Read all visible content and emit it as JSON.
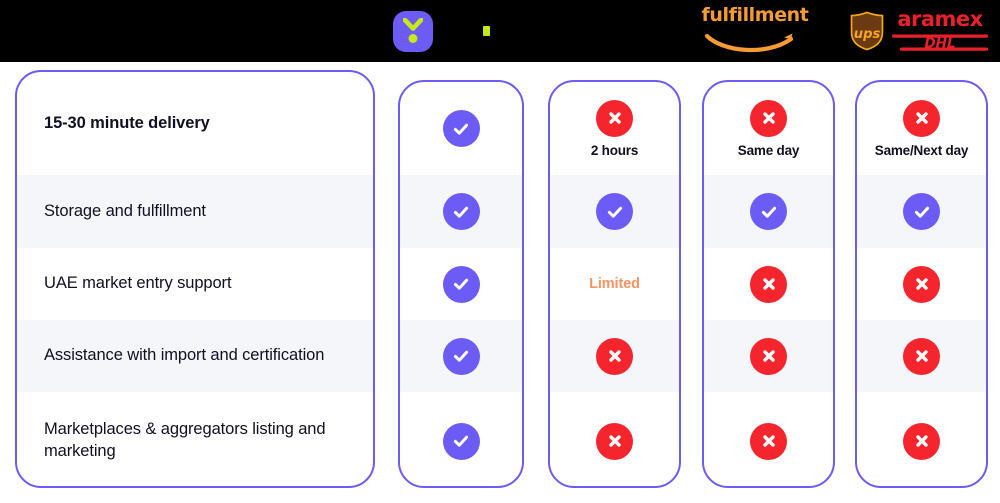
{
  "header": {
    "background": "#000000",
    "logos": [
      {
        "name": "brand-logo",
        "label": "Y",
        "colors": {
          "bg": "#6c5cf5",
          "mark": "#c8e819"
        }
      },
      {
        "name": "partial-logo",
        "label": "",
        "colors": {
          "mark": "#c8e819"
        }
      },
      {
        "name": "amazon-fulfillment-logo",
        "label": "fulfillment",
        "colors": {
          "mark": "#f79b34"
        }
      },
      {
        "name": "carrier-logos",
        "ups_label": "ups",
        "aramex_label": "aramex",
        "dhl_label": "DHL",
        "colors": {
          "ups": "#6b3a11",
          "ups_gold": "#f5a623",
          "red": "#e8212b"
        }
      }
    ]
  },
  "theme": {
    "purple": "#6c5cf5",
    "red": "#f5252d",
    "orange": "#f89461",
    "band": "#f5f6fa",
    "text": "#101021"
  },
  "table": {
    "features": [
      {
        "label": "15-30 minute delivery",
        "bold": true,
        "shaded": false
      },
      {
        "label": "Storage and fulfillment",
        "bold": false,
        "shaded": true
      },
      {
        "label": "UAE market entry support",
        "bold": false,
        "shaded": false
      },
      {
        "label": "Assistance with import and certification",
        "bold": false,
        "shaded": true
      },
      {
        "label": "Marketplaces & aggregators listing and marketing",
        "bold": false,
        "shaded": false
      }
    ],
    "columns": [
      {
        "name": "brand-column",
        "cells": [
          {
            "icon": "check-icon",
            "state": "yes",
            "note": ""
          },
          {
            "icon": "check-icon",
            "state": "yes",
            "note": ""
          },
          {
            "icon": "check-icon",
            "state": "yes",
            "note": ""
          },
          {
            "icon": "check-icon",
            "state": "yes",
            "note": ""
          },
          {
            "icon": "check-icon",
            "state": "yes",
            "note": ""
          }
        ]
      },
      {
        "name": "partial-column",
        "cells": [
          {
            "icon": "cross-icon",
            "state": "no",
            "note": "2 hours"
          },
          {
            "icon": "check-icon",
            "state": "yes",
            "note": ""
          },
          {
            "icon": "text-icon",
            "state": "text",
            "note": "Limited"
          },
          {
            "icon": "cross-icon",
            "state": "no",
            "note": ""
          },
          {
            "icon": "cross-icon",
            "state": "no",
            "note": ""
          }
        ]
      },
      {
        "name": "amazon-column",
        "cells": [
          {
            "icon": "cross-icon",
            "state": "no",
            "note": "Same day"
          },
          {
            "icon": "check-icon",
            "state": "yes",
            "note": ""
          },
          {
            "icon": "cross-icon",
            "state": "no",
            "note": ""
          },
          {
            "icon": "cross-icon",
            "state": "no",
            "note": ""
          },
          {
            "icon": "cross-icon",
            "state": "no",
            "note": ""
          }
        ]
      },
      {
        "name": "carriers-column",
        "cells": [
          {
            "icon": "cross-icon",
            "state": "no",
            "note": "Same/Next day"
          },
          {
            "icon": "check-icon",
            "state": "yes",
            "note": ""
          },
          {
            "icon": "cross-icon",
            "state": "no",
            "note": ""
          },
          {
            "icon": "cross-icon",
            "state": "no",
            "note": ""
          },
          {
            "icon": "cross-icon",
            "state": "no",
            "note": ""
          }
        ]
      }
    ]
  }
}
